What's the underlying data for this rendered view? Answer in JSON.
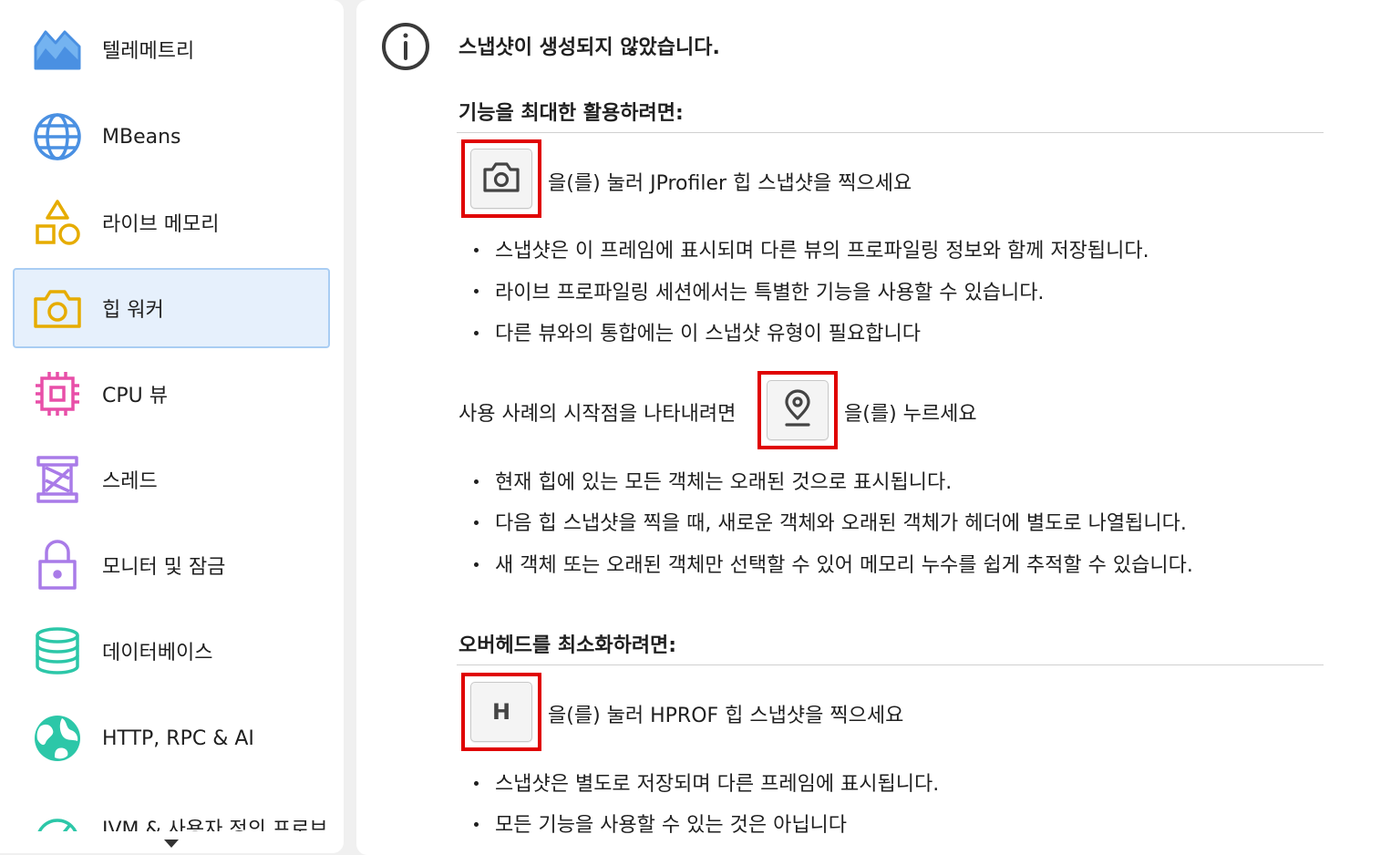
{
  "sidebar": {
    "items": [
      {
        "label": "텔레메트리",
        "icon": "telemetry-icon"
      },
      {
        "label": "MBeans",
        "icon": "globe-icon"
      },
      {
        "label": "라이브 메모리",
        "icon": "shapes-icon"
      },
      {
        "label": "힙 워커",
        "icon": "camera-icon",
        "selected": true
      },
      {
        "label": "CPU 뷰",
        "icon": "cpu-icon"
      },
      {
        "label": "스레드",
        "icon": "spool-icon"
      },
      {
        "label": "모니터 및 잠금",
        "icon": "lock-icon"
      },
      {
        "label": "데이터베이스",
        "icon": "database-icon"
      },
      {
        "label": "HTTP, RPC & AI",
        "icon": "earth-icon"
      },
      {
        "label": "JVM & 사용자 정의 프로브",
        "icon": "gauge-icon"
      }
    ]
  },
  "main": {
    "title": "스냅샷이 생성되지 않았습니다.",
    "section1": {
      "heading": "기능을 최대한 활용하려면:",
      "action_text": "을(를) 눌러 JProfiler 힙 스냅샷을 찍으세요",
      "bullets": [
        "스냅샷은 이 프레임에 표시되며 다른 뷰의 프로파일링 정보와 함께 저장됩니다.",
        "라이브 프로파일링 세션에서는 특별한 기능을 사용할 수 있습니다.",
        "다른 뷰와의 통합에는 이 스냅샷 유형이 필요합니다"
      ],
      "mark_text_before": "사용 사례의 시작점을 나타내려면",
      "mark_text_after": "을(를) 누르세요",
      "mark_bullets": [
        "현재 힙에 있는 모든 객체는 오래된 것으로 표시됩니다.",
        "다음 힙 스냅샷을 찍을 때, 새로운 객체와 오래된 객체가 헤더에 별도로 나열됩니다.",
        "새 객체 또는 오래된 객체만 선택할 수 있어 메모리 누수를 쉽게 추적할 수 있습니다."
      ]
    },
    "section2": {
      "heading": "오버헤드를 최소화하려면:",
      "button_letter": "H",
      "action_text": "을(를) 눌러 HPROF 힙 스냅샷을 찍으세요",
      "bullets": [
        "스냅샷은 별도로 저장되며 다른 프레임에 표시됩니다.",
        "모든 기능을 사용할 수 있는 것은 아닙니다"
      ]
    }
  },
  "colors": {
    "highlight_border": "#e00000",
    "selected_bg": "#e6f0fc",
    "selected_border": "#a9cdf3"
  }
}
